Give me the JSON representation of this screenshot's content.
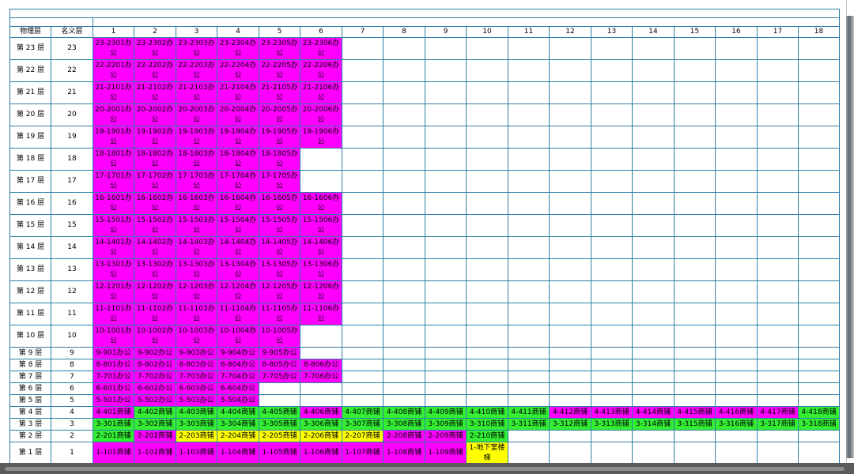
{
  "title_text": "",
  "colors": {
    "office": "#ff00ff",
    "shop_green": "#33ee33",
    "shop_magenta": "#ff00ff",
    "shop_yellow": "#ffff00",
    "grid_line": "#2e7ea6"
  },
  "table": {
    "header_physical": "物理层",
    "header_nominal": "名义层",
    "columns": [
      "1",
      "2",
      "3",
      "4",
      "5",
      "6",
      "7",
      "8",
      "9",
      "10",
      "11",
      "12",
      "13",
      "14",
      "15",
      "16",
      "17",
      "18"
    ],
    "rows": [
      {
        "physical": "第 23 层",
        "nominal": "23",
        "tall": true,
        "cells": [
          {
            "t": "23-2301办公",
            "c": "m"
          },
          {
            "t": "23-2302办公",
            "c": "m"
          },
          {
            "t": "23-2303办公",
            "c": "m"
          },
          {
            "t": "23-2304办公",
            "c": "m"
          },
          {
            "t": "23-2305办公",
            "c": "m"
          },
          {
            "t": "23-2306办公",
            "c": "m"
          }
        ]
      },
      {
        "physical": "第 22 层",
        "nominal": "22",
        "tall": true,
        "cells": [
          {
            "t": "22-2201办公",
            "c": "m"
          },
          {
            "t": "22-2202办公",
            "c": "m"
          },
          {
            "t": "22-2203办公",
            "c": "m"
          },
          {
            "t": "22-2204办公",
            "c": "m"
          },
          {
            "t": "22-2205办公",
            "c": "m"
          },
          {
            "t": "22-2206办公",
            "c": "m"
          }
        ]
      },
      {
        "physical": "第 21 层",
        "nominal": "21",
        "tall": true,
        "cells": [
          {
            "t": "21-2101办公",
            "c": "m"
          },
          {
            "t": "21-2102办公",
            "c": "m"
          },
          {
            "t": "21-2103办公",
            "c": "m"
          },
          {
            "t": "21-2104办公",
            "c": "m"
          },
          {
            "t": "21-2105办公",
            "c": "m"
          },
          {
            "t": "21-2106办公",
            "c": "m"
          }
        ]
      },
      {
        "physical": "第 20 层",
        "nominal": "20",
        "tall": true,
        "cells": [
          {
            "t": "20-2001办公",
            "c": "m"
          },
          {
            "t": "20-2002办公",
            "c": "m"
          },
          {
            "t": "20-2003办公",
            "c": "m"
          },
          {
            "t": "20-2004办公",
            "c": "m"
          },
          {
            "t": "20-2005办公",
            "c": "m"
          },
          {
            "t": "20-2006办公",
            "c": "m"
          }
        ]
      },
      {
        "physical": "第 19 层",
        "nominal": "19",
        "tall": true,
        "cells": [
          {
            "t": "19-1901办公",
            "c": "m"
          },
          {
            "t": "19-1902办公",
            "c": "m"
          },
          {
            "t": "19-1903办公",
            "c": "m"
          },
          {
            "t": "19-1904办公",
            "c": "m"
          },
          {
            "t": "19-1905办公",
            "c": "m"
          },
          {
            "t": "19-1906办公",
            "c": "m"
          }
        ]
      },
      {
        "physical": "第 18 层",
        "nominal": "18",
        "tall": true,
        "cells": [
          {
            "t": "18-1801办公",
            "c": "m"
          },
          {
            "t": "18-1802办公",
            "c": "m"
          },
          {
            "t": "18-1803办公",
            "c": "m"
          },
          {
            "t": "18-1804办公",
            "c": "m"
          },
          {
            "t": "18-1805办公",
            "c": "m"
          }
        ]
      },
      {
        "physical": "第 17 层",
        "nominal": "17",
        "tall": true,
        "cells": [
          {
            "t": "17-1701办公",
            "c": "m"
          },
          {
            "t": "17-1702办公",
            "c": "m"
          },
          {
            "t": "17-1703办公",
            "c": "m"
          },
          {
            "t": "17-1704办公",
            "c": "m"
          },
          {
            "t": "17-1705办公",
            "c": "m"
          }
        ]
      },
      {
        "physical": "第 16 层",
        "nominal": "16",
        "tall": true,
        "cells": [
          {
            "t": "16-1601办公",
            "c": "m"
          },
          {
            "t": "16-1602办公",
            "c": "m"
          },
          {
            "t": "16-1603办公",
            "c": "m"
          },
          {
            "t": "16-1604办公",
            "c": "m"
          },
          {
            "t": "16-1605办公",
            "c": "m"
          },
          {
            "t": "16-1606办公",
            "c": "m"
          }
        ]
      },
      {
        "physical": "第 15 层",
        "nominal": "15",
        "tall": true,
        "cells": [
          {
            "t": "15-1501办公",
            "c": "m"
          },
          {
            "t": "15-1502办公",
            "c": "m"
          },
          {
            "t": "15-1503办公",
            "c": "m"
          },
          {
            "t": "15-1504办公",
            "c": "m"
          },
          {
            "t": "15-1505办公",
            "c": "m"
          },
          {
            "t": "15-1506办公",
            "c": "m"
          }
        ]
      },
      {
        "physical": "第 14 层",
        "nominal": "14",
        "tall": true,
        "cells": [
          {
            "t": "14-1401办公",
            "c": "m"
          },
          {
            "t": "14-1402办公",
            "c": "m"
          },
          {
            "t": "14-1403办公",
            "c": "m"
          },
          {
            "t": "14-1404办公",
            "c": "m"
          },
          {
            "t": "14-1405办公",
            "c": "m"
          },
          {
            "t": "14-1406办公",
            "c": "m"
          }
        ]
      },
      {
        "physical": "第 13 层",
        "nominal": "13",
        "tall": true,
        "cells": [
          {
            "t": "13-1301办公",
            "c": "m"
          },
          {
            "t": "13-1302办公",
            "c": "m"
          },
          {
            "t": "13-1303办公",
            "c": "m"
          },
          {
            "t": "13-1304办公",
            "c": "m"
          },
          {
            "t": "13-1305办公",
            "c": "m"
          },
          {
            "t": "13-1306办公",
            "c": "m"
          }
        ]
      },
      {
        "physical": "第 12 层",
        "nominal": "12",
        "tall": true,
        "cells": [
          {
            "t": "12-1201办公",
            "c": "m"
          },
          {
            "t": "12-1202办公",
            "c": "m"
          },
          {
            "t": "12-1203办公",
            "c": "m"
          },
          {
            "t": "12-1204办公",
            "c": "m"
          },
          {
            "t": "12-1205办公",
            "c": "m"
          },
          {
            "t": "12-1206办公",
            "c": "m"
          }
        ]
      },
      {
        "physical": "第 11 层",
        "nominal": "11",
        "tall": true,
        "cells": [
          {
            "t": "11-1101办公",
            "c": "m"
          },
          {
            "t": "11-1102办公",
            "c": "m"
          },
          {
            "t": "11-1103办公",
            "c": "m"
          },
          {
            "t": "11-1104办公",
            "c": "m"
          },
          {
            "t": "11-1105办公",
            "c": "m"
          },
          {
            "t": "11-1106办公",
            "c": "m"
          }
        ]
      },
      {
        "physical": "第 10 层",
        "nominal": "10",
        "tall": true,
        "cells": [
          {
            "t": "10-1001办公",
            "c": "m"
          },
          {
            "t": "10-1002办公",
            "c": "m"
          },
          {
            "t": "10-1003办公",
            "c": "m"
          },
          {
            "t": "10-1004办公",
            "c": "m"
          },
          {
            "t": "10-1005办公",
            "c": "m"
          }
        ]
      },
      {
        "physical": "第 9 层",
        "nominal": "9",
        "tall": false,
        "cells": [
          {
            "t": "9-901办公",
            "c": "m"
          },
          {
            "t": "9-902办公",
            "c": "m"
          },
          {
            "t": "9-903办公",
            "c": "m"
          },
          {
            "t": "9-904办公",
            "c": "m"
          },
          {
            "t": "9-905办公",
            "c": "m"
          }
        ]
      },
      {
        "physical": "第 8 层",
        "nominal": "8",
        "tall": false,
        "cells": [
          {
            "t": "8-801办公",
            "c": "m"
          },
          {
            "t": "8-802办公",
            "c": "m"
          },
          {
            "t": "8-803办公",
            "c": "m"
          },
          {
            "t": "8-804办公",
            "c": "m"
          },
          {
            "t": "8-805办公",
            "c": "m"
          },
          {
            "t": "8-806办公",
            "c": "m"
          }
        ]
      },
      {
        "physical": "第 7 层",
        "nominal": "7",
        "tall": false,
        "cells": [
          {
            "t": "7-701办公",
            "c": "m"
          },
          {
            "t": "7-702办公",
            "c": "m"
          },
          {
            "t": "7-703办公",
            "c": "m"
          },
          {
            "t": "7-704办公",
            "c": "m"
          },
          {
            "t": "7-705办公",
            "c": "m"
          },
          {
            "t": "7-706办公",
            "c": "m"
          }
        ]
      },
      {
        "physical": "第 6 层",
        "nominal": "6",
        "tall": false,
        "cells": [
          {
            "t": "6-601办公",
            "c": "m"
          },
          {
            "t": "6-602办公",
            "c": "m"
          },
          {
            "t": "6-603办公",
            "c": "m"
          },
          {
            "t": "6-604办公",
            "c": "m"
          }
        ]
      },
      {
        "physical": "第 5 层",
        "nominal": "5",
        "tall": false,
        "cells": [
          {
            "t": "5-501办公",
            "c": "m"
          },
          {
            "t": "5-502办公",
            "c": "m"
          },
          {
            "t": "5-503办公",
            "c": "m"
          },
          {
            "t": "5-504办公",
            "c": "m"
          }
        ]
      },
      {
        "physical": "第 4 层",
        "nominal": "4",
        "tall": false,
        "cells": [
          {
            "t": "4-401商铺",
            "c": "m"
          },
          {
            "t": "4-402商铺",
            "c": "g"
          },
          {
            "t": "4-403商铺",
            "c": "g"
          },
          {
            "t": "4-404商铺",
            "c": "g"
          },
          {
            "t": "4-405商铺",
            "c": "g"
          },
          {
            "t": "4-406商铺",
            "c": "m"
          },
          {
            "t": "4-407商铺",
            "c": "g"
          },
          {
            "t": "4-408商铺",
            "c": "g"
          },
          {
            "t": "4-409商铺",
            "c": "g"
          },
          {
            "t": "4-410商铺",
            "c": "g"
          },
          {
            "t": "4-411商铺",
            "c": "g"
          },
          {
            "t": "4-412商铺",
            "c": "m"
          },
          {
            "t": "4-413商铺",
            "c": "m"
          },
          {
            "t": "4-414商铺",
            "c": "m"
          },
          {
            "t": "4-415商铺",
            "c": "m"
          },
          {
            "t": "4-416商铺",
            "c": "m"
          },
          {
            "t": "4-417商铺",
            "c": "m"
          },
          {
            "t": "4-418商铺",
            "c": "g"
          }
        ]
      },
      {
        "physical": "第 3 层",
        "nominal": "3",
        "tall": false,
        "cells": [
          {
            "t": "3-301商铺",
            "c": "g"
          },
          {
            "t": "3-302商铺",
            "c": "g"
          },
          {
            "t": "3-303商铺",
            "c": "g"
          },
          {
            "t": "3-304商铺",
            "c": "g"
          },
          {
            "t": "3-305商铺",
            "c": "g"
          },
          {
            "t": "3-306商铺",
            "c": "g"
          },
          {
            "t": "3-307商铺",
            "c": "g"
          },
          {
            "t": "3-308商铺",
            "c": "g"
          },
          {
            "t": "3-309商铺",
            "c": "g"
          },
          {
            "t": "3-310商铺",
            "c": "g"
          },
          {
            "t": "3-311商铺",
            "c": "g"
          },
          {
            "t": "3-312商铺",
            "c": "g"
          },
          {
            "t": "3-313商铺",
            "c": "g"
          },
          {
            "t": "3-314商铺",
            "c": "g"
          },
          {
            "t": "3-315商铺",
            "c": "g"
          },
          {
            "t": "3-316商铺",
            "c": "g"
          },
          {
            "t": "3-317商铺",
            "c": "g"
          },
          {
            "t": "3-318商铺",
            "c": "g"
          }
        ]
      },
      {
        "physical": "第 2 层",
        "nominal": "2",
        "tall": false,
        "cells": [
          {
            "t": "2-201商铺",
            "c": "g"
          },
          {
            "t": "2-202商铺",
            "c": "m"
          },
          {
            "t": "2-203商铺",
            "c": "y"
          },
          {
            "t": "2-204商铺",
            "c": "y"
          },
          {
            "t": "2-205商铺",
            "c": "y"
          },
          {
            "t": "2-206商铺",
            "c": "y"
          },
          {
            "t": "2-207商铺",
            "c": "y"
          },
          {
            "t": "2-208商铺",
            "c": "m"
          },
          {
            "t": "2-209商铺",
            "c": "m"
          },
          {
            "t": "2-210商铺",
            "c": "g"
          }
        ]
      },
      {
        "physical": "第 1 层",
        "nominal": "1",
        "tall": true,
        "cells": [
          {
            "t": "1-101商铺",
            "c": "m"
          },
          {
            "t": "1-102商铺",
            "c": "m"
          },
          {
            "t": "1-103商铺",
            "c": "m"
          },
          {
            "t": "1-104商铺",
            "c": "m"
          },
          {
            "t": "1-105商铺",
            "c": "m"
          },
          {
            "t": "1-106商铺",
            "c": "m"
          },
          {
            "t": "1-107商铺",
            "c": "m"
          },
          {
            "t": "1-108商铺",
            "c": "m"
          },
          {
            "t": "1-109商铺",
            "c": "m"
          },
          {
            "t": "1-地下室楼梯",
            "c": "y"
          }
        ]
      }
    ]
  }
}
